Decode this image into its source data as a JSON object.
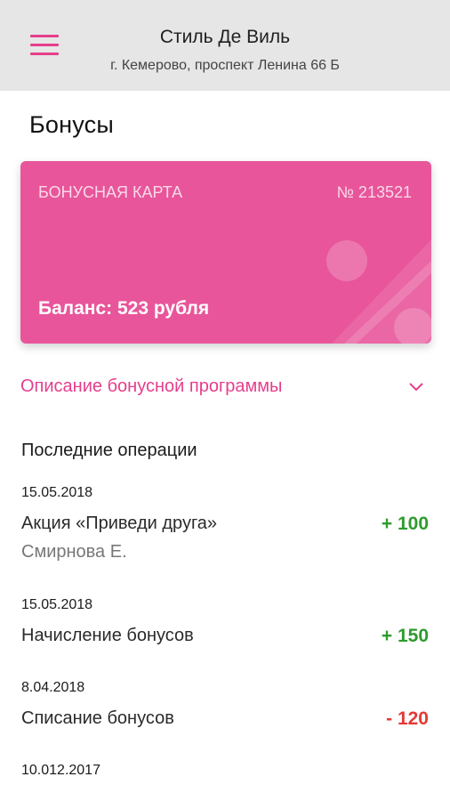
{
  "header": {
    "shop_name": "Стиль Де Виль",
    "address": "г. Кемерово, проспект Ленина 66 Б",
    "menu_icon": "hamburger-menu-icon"
  },
  "page": {
    "title": "Бонусы"
  },
  "card": {
    "label": "БОНУСНАЯ КАРТА",
    "number": "№ 213521",
    "balance": "Баланс: 523 рубля",
    "color": "#e8559a"
  },
  "program": {
    "link_text": "Описание бонусной программы",
    "icon": "chevron-down-icon",
    "accent": "#e63e8c"
  },
  "operations": {
    "heading": "Последние операции",
    "items": [
      {
        "date": "15.05.2018",
        "title": "Акция «Приведи друга»",
        "subtitle": "Смирнова Е.",
        "amount": "+ 100"
      },
      {
        "date": "15.05.2018",
        "title": "Начисление бонусов",
        "subtitle": "",
        "amount": "+ 150"
      },
      {
        "date": "8.04.2018",
        "title": "Списание бонусов",
        "subtitle": "",
        "amount": "- 120"
      },
      {
        "date": "10.012.2017",
        "title": "",
        "subtitle": "",
        "amount": ""
      }
    ],
    "positive_color": "#2e9b2e",
    "negative_color": "#e53935"
  }
}
